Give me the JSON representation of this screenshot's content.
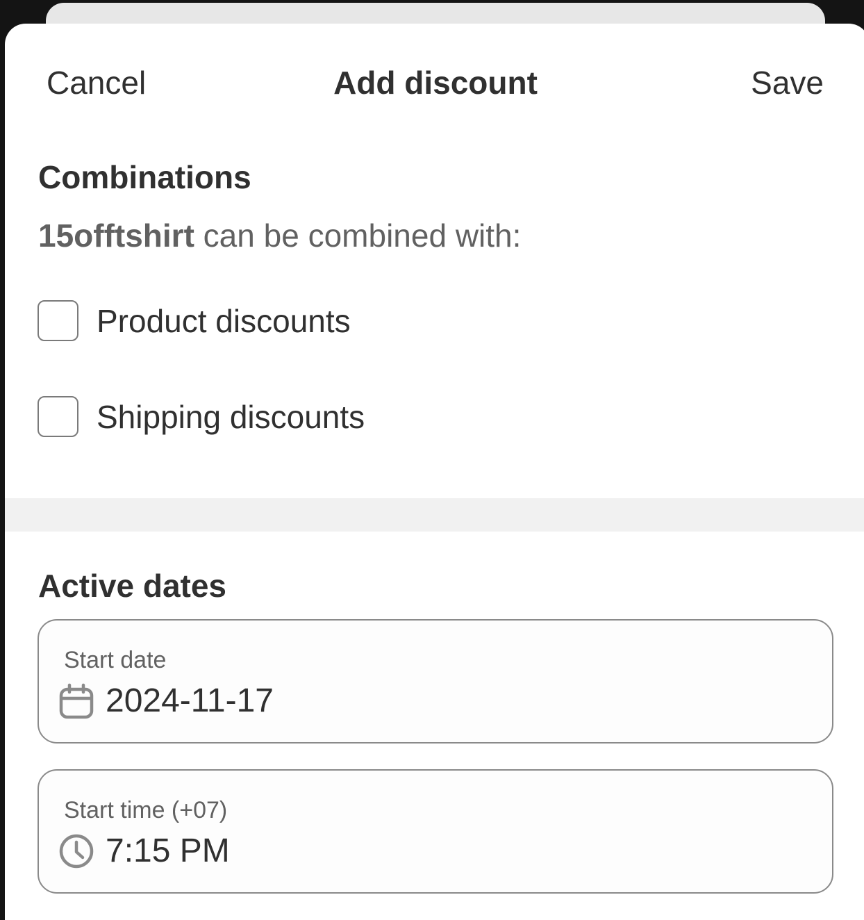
{
  "header": {
    "cancel_label": "Cancel",
    "title": "Add discount",
    "save_label": "Save"
  },
  "combinations": {
    "title": "Combinations",
    "discount_code": "15offtshirt",
    "combine_text": " can be combined with:",
    "options": [
      {
        "label": "Product discounts",
        "checked": false
      },
      {
        "label": "Shipping discounts",
        "checked": false
      }
    ]
  },
  "active_dates": {
    "title": "Active dates",
    "start_date": {
      "label": "Start date",
      "value": "2024-11-17",
      "icon": "calendar-icon"
    },
    "start_time": {
      "label": "Start time (+07)",
      "value": "7:15 PM",
      "icon": "clock-icon"
    }
  }
}
